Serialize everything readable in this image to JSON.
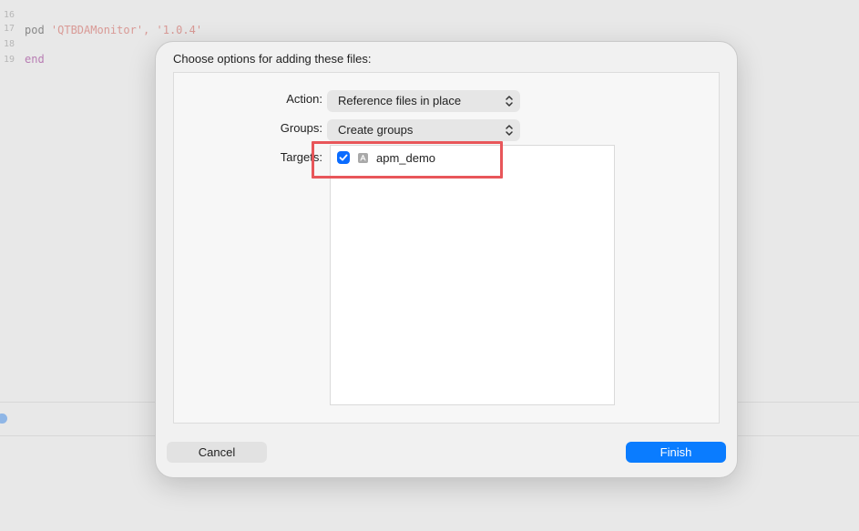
{
  "editor": {
    "lines": [
      {
        "number": "16",
        "code_prefix": "pod ",
        "code_str": "'QTBDAMonitor', '1.0.4'",
        "clipped": true
      },
      {
        "number": "17",
        "code": ""
      },
      {
        "number": "18",
        "code_keyword": "end"
      },
      {
        "number": "19",
        "code": ""
      }
    ]
  },
  "sheet": {
    "title": "Choose options for adding these files:",
    "action": {
      "label": "Action:",
      "value": "Reference files in place"
    },
    "groups": {
      "label": "Groups:",
      "value": "Create groups"
    },
    "targets": {
      "label": "Targets:",
      "items": [
        {
          "name": "apm_demo",
          "checked": true,
          "icon": "app-target-icon"
        }
      ]
    },
    "buttons": {
      "cancel": "Cancel",
      "finish": "Finish"
    }
  },
  "colors": {
    "accent": "#0a7cff",
    "highlight": "#e8565a",
    "keyword": "#b87db3"
  }
}
